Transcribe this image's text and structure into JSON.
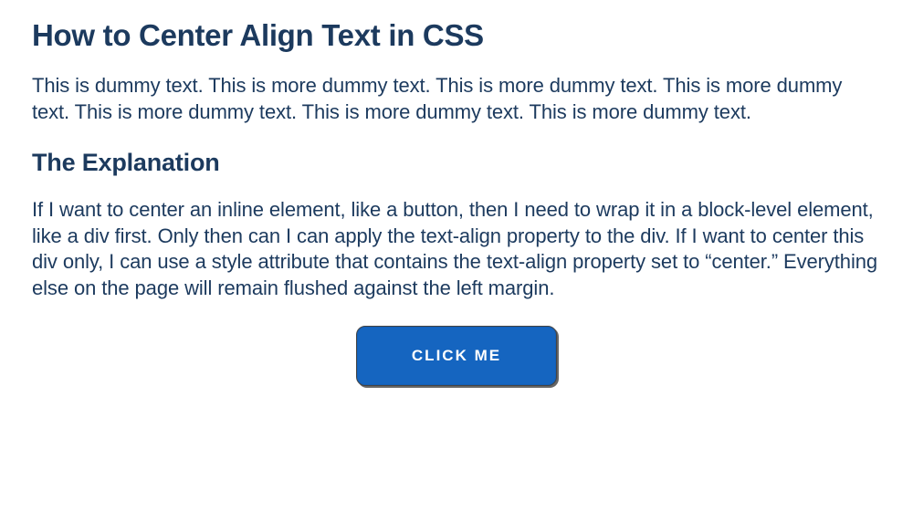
{
  "heading": "How to Center Align Text in CSS",
  "intro": "This is dummy text. This is more dummy text. This is more dummy text. This is more dummy text. This is more dummy text. This is more dummy text. This is more dummy text.",
  "subheading": "The Explanation",
  "explanation": "If I want to center an inline element, like a button, then I need to wrap it in a block-level element, like a div first. Only then can I can apply the text-align property to the div. If I want to center this div only, I can use a style attribute that contains the text-align property set to “center.” Everything else on the page will remain flushed against the left margin.",
  "button_label": "CLICK ME"
}
